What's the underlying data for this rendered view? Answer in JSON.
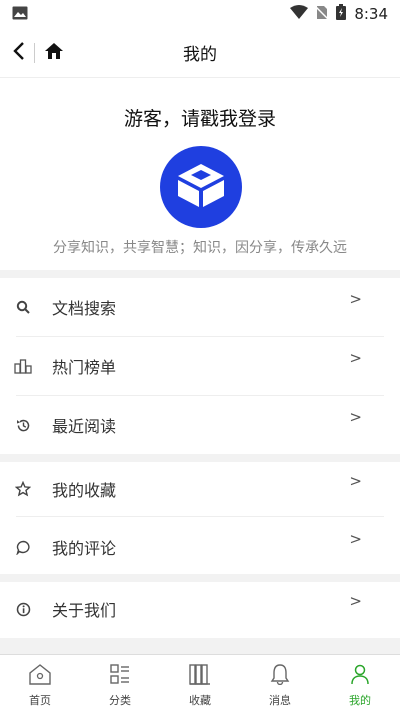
{
  "status": {
    "time": "8:34"
  },
  "nav": {
    "title": "我的"
  },
  "profile": {
    "login_prompt": "游客，请戳我登录",
    "slogan": "分享知识，共享智慧；知识，因分享，传承久远"
  },
  "menu": {
    "items": [
      {
        "label": "文档搜索",
        "icon": "search-icon"
      },
      {
        "label": "热门榜单",
        "icon": "ranking-icon"
      },
      {
        "label": "最近阅读",
        "icon": "history-icon"
      },
      {
        "label": "我的收藏",
        "icon": "star-icon"
      },
      {
        "label": "我的评论",
        "icon": "comment-icon"
      },
      {
        "label": "关于我们",
        "icon": "info-icon"
      }
    ],
    "chevron": ">"
  },
  "tabs": [
    {
      "label": "首页",
      "icon": "home-icon"
    },
    {
      "label": "分类",
      "icon": "category-icon"
    },
    {
      "label": "收藏",
      "icon": "books-icon"
    },
    {
      "label": "消息",
      "icon": "bell-icon"
    },
    {
      "label": "我的",
      "icon": "person-icon",
      "active": true
    }
  ],
  "colors": {
    "accent": "#2aa52a",
    "avatar_bg": "#1f3fe0"
  }
}
